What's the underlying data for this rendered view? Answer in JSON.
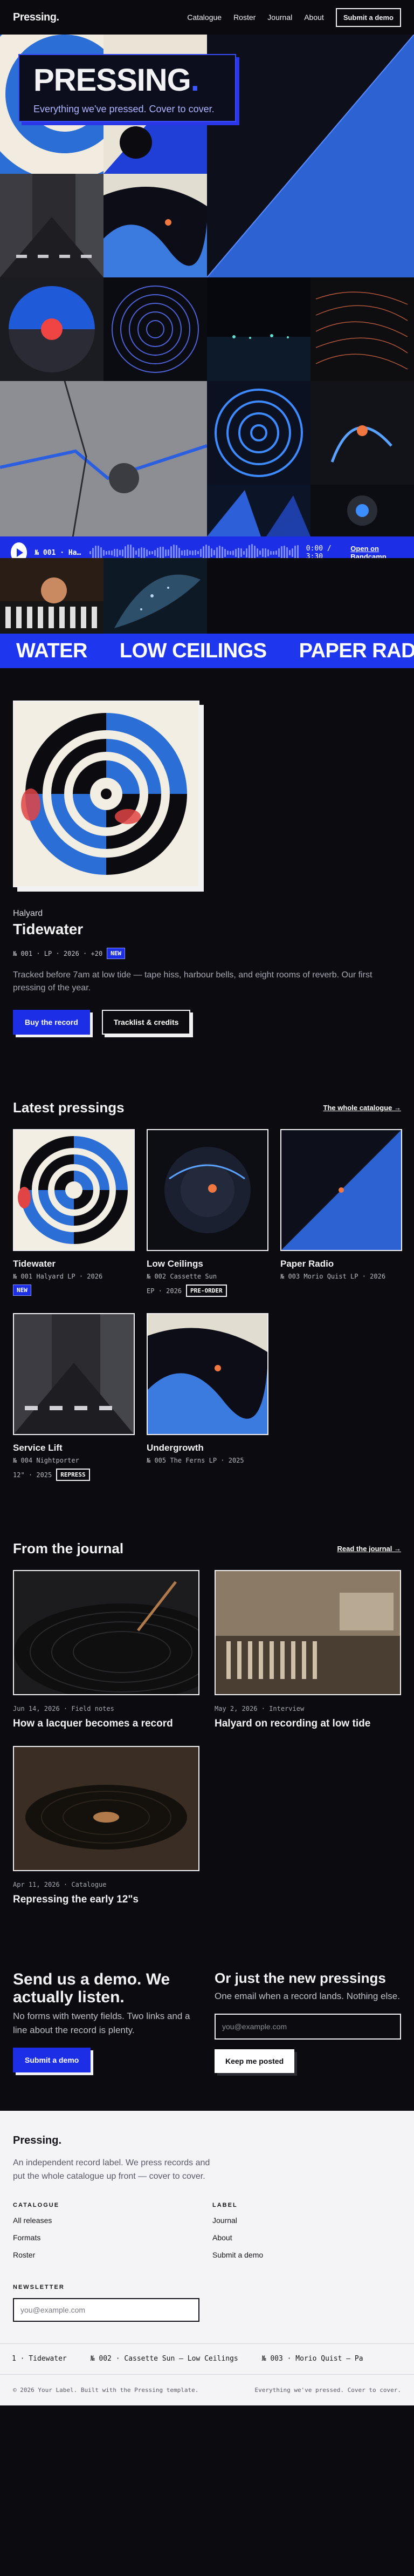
{
  "header": {
    "brand": "Pressing.",
    "nav": [
      "Catalogue",
      "Roster",
      "Journal",
      "About"
    ],
    "cta": "Submit a demo"
  },
  "hero": {
    "title": "PRESSING",
    "title_dot": ".",
    "subtitle": "Everything we've pressed. Cover to cover."
  },
  "player": {
    "track": "№ 001 · Ha…",
    "time": "0:00 / 3:30",
    "link": "Open on Bandcamp"
  },
  "ticker": [
    "WATER",
    "LOW CEILINGS",
    "PAPER RAD"
  ],
  "featured": {
    "artist": "Halyard",
    "title": "Tidewater",
    "meta": "№ 001 · LP · 2026 · +20",
    "badge": "NEW",
    "description": "Tracked before 7am at low tide — tape hiss, harbour bells, and eight rooms of reverb. Our first pressing of the year.",
    "buy": "Buy the record",
    "tracklist": "Tracklist & credits"
  },
  "latest": {
    "title": "Latest pressings",
    "link": "The whole catalogue →",
    "items": [
      {
        "title": "Tidewater",
        "meta": "№ 001 Halyard LP · 2026",
        "meta2": "",
        "badge": "NEW"
      },
      {
        "title": "Low Ceilings",
        "meta": "№ 002 Cassette Sun",
        "meta2": "EP · 2026",
        "badge": "PRE-ORDER"
      },
      {
        "title": "Paper Radio",
        "meta": "№ 003 Morio Quist LP · 2026",
        "meta2": "",
        "badge": ""
      },
      {
        "title": "Service Lift",
        "meta": "№ 004 Nightporter",
        "meta2": "12\" · 2025",
        "badge": "REPRESS"
      },
      {
        "title": "Undergrowth",
        "meta": "№ 005 The Ferns LP · 2025",
        "meta2": "",
        "badge": ""
      }
    ]
  },
  "journal": {
    "title": "From the journal",
    "link": "Read the journal →",
    "posts": [
      {
        "meta": "Jun 14, 2026 · Field notes",
        "title": "How a lacquer becomes a record"
      },
      {
        "meta": "May 2, 2026 · Interview",
        "title": "Halyard on recording at low tide"
      },
      {
        "meta": "Apr 11, 2026 · Catalogue",
        "title": "Repressing the early 12\"s"
      }
    ]
  },
  "demo": {
    "title": "Send us a demo. We actually listen.",
    "body": "No forms with twenty fields. Two links and a line about the record is plenty.",
    "button": "Submit a demo"
  },
  "newsletter": {
    "title": "Or just the new pressings",
    "body": "One email when a record lands. Nothing else.",
    "placeholder": "you@example.com",
    "button": "Keep me posted"
  },
  "footer": {
    "brand": "Pressing.",
    "description": "An independent record label. We press records and put the whole catalogue up front — cover to cover.",
    "catalogue_head": "CATALOGUE",
    "catalogue_links": [
      "All releases",
      "Formats",
      "Roster"
    ],
    "label_head": "LABEL",
    "label_links": [
      "Journal",
      "About",
      "Submit a demo"
    ],
    "newsletter_head": "NEWSLETTER",
    "newsletter_placeholder": "you@example.com",
    "ticker": [
      "1 · Tidewater",
      "№ 002 · Cassette Sun — Low Ceilings",
      "№ 003 · Morio Quist — Pa"
    ],
    "copyright": "© 2026 Your Label. Built with the Pressing template.",
    "tagline": "Everything we've pressed. Cover to cover."
  },
  "colors": {
    "accent": "#1d2fe6",
    "background": "#0c0c10",
    "footer_bg": "#f4f4f6"
  }
}
